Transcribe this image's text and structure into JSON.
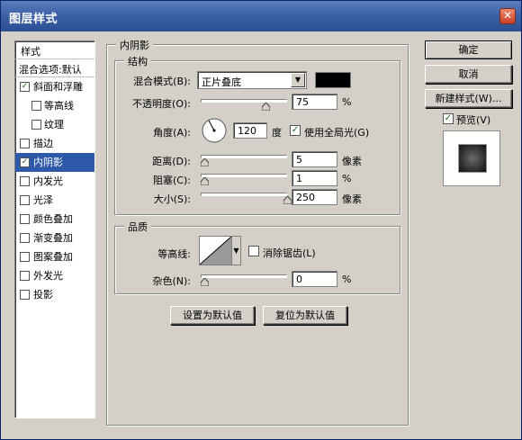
{
  "window": {
    "title": "图层样式",
    "close_glyph": "✕"
  },
  "sidebar": {
    "header": "样式",
    "blend_options": "混合选项:默认",
    "items": [
      {
        "label": "斜面和浮雕",
        "checked": true,
        "indent": false,
        "selected": false
      },
      {
        "label": "等高线",
        "checked": false,
        "indent": true,
        "selected": false
      },
      {
        "label": "纹理",
        "checked": false,
        "indent": true,
        "selected": false
      },
      {
        "label": "描边",
        "checked": false,
        "indent": false,
        "selected": false
      },
      {
        "label": "内阴影",
        "checked": true,
        "indent": false,
        "selected": true
      },
      {
        "label": "内发光",
        "checked": false,
        "indent": false,
        "selected": false
      },
      {
        "label": "光泽",
        "checked": false,
        "indent": false,
        "selected": false
      },
      {
        "label": "颜色叠加",
        "checked": false,
        "indent": false,
        "selected": false
      },
      {
        "label": "渐变叠加",
        "checked": false,
        "indent": false,
        "selected": false
      },
      {
        "label": "图案叠加",
        "checked": false,
        "indent": false,
        "selected": false
      },
      {
        "label": "外发光",
        "checked": false,
        "indent": false,
        "selected": false
      },
      {
        "label": "投影",
        "checked": false,
        "indent": false,
        "selected": false
      }
    ]
  },
  "inner_shadow": {
    "title": "内阴影",
    "structure": {
      "title": "结构",
      "blend_mode_label": "混合模式(B):",
      "blend_mode_value": "正片叠底",
      "swatch_color": "#000000",
      "opacity_label": "不透明度(O):",
      "opacity_value": "75",
      "opacity_unit": "%",
      "opacity_fraction": 0.75,
      "angle_label": "角度(A):",
      "angle_value": "120",
      "angle_unit": "度",
      "global_light_label": "使用全局光(G)",
      "global_light_checked": true,
      "distance_label": "距离(D):",
      "distance_value": "5",
      "distance_unit": "像素",
      "choke_label": "阻塞(C):",
      "choke_value": "1",
      "choke_unit": "%",
      "size_label": "大小(S):",
      "size_value": "250",
      "size_unit": "像素"
    },
    "quality": {
      "title": "品质",
      "contour_label": "等高线:",
      "antialias_label": "消除锯齿(L)",
      "antialias_checked": false,
      "noise_label": "杂色(N):",
      "noise_value": "0",
      "noise_unit": "%"
    },
    "buttons": {
      "make_default": "设置为默认值",
      "reset_default": "复位为默认值"
    }
  },
  "right": {
    "ok": "确定",
    "cancel": "取消",
    "new_style": "新建样式(W)...",
    "preview_label": "预览(V)",
    "preview_checked": true
  },
  "icons": {
    "check": "✓",
    "dropdown": "▼"
  }
}
